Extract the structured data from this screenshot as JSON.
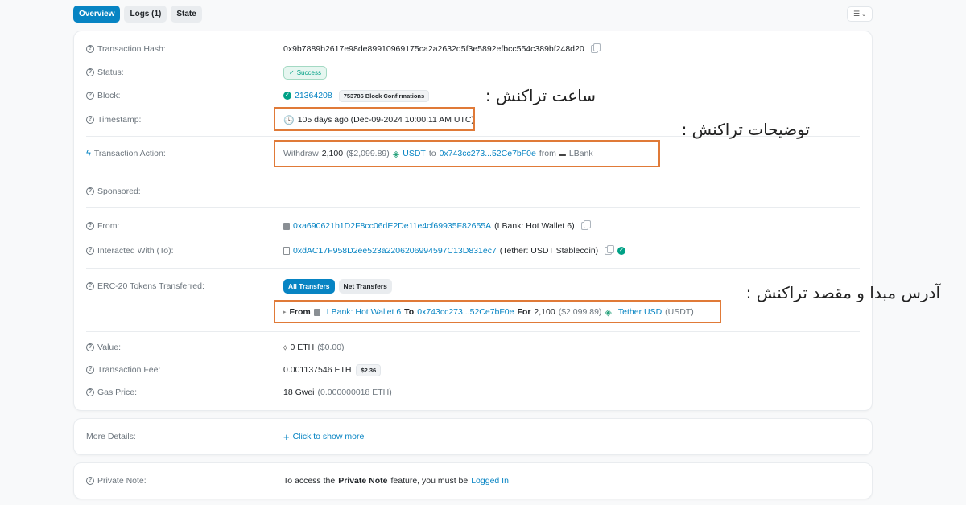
{
  "tabs": [
    {
      "label": "Overview",
      "active": true
    },
    {
      "label": "Logs (1)",
      "active": false
    },
    {
      "label": "State",
      "active": false
    }
  ],
  "tx": {
    "hash_label": "Transaction Hash:",
    "hash": "0x9b7889b2617e98de89910969175ca2a2632d5f3e5892efbcc554c389bf248d20",
    "status_label": "Status:",
    "status": "Success",
    "block_label": "Block:",
    "block": "21364208",
    "confirmations": "753786 Block Confirmations",
    "timestamp_label": "Timestamp:",
    "timestamp": "105 days ago (Dec-09-2024 10:00:11 AM UTC)",
    "action_label": "Transaction Action:",
    "action": {
      "verb": "Withdraw",
      "amount": "2,100",
      "usd": "($2,099.89)",
      "token": "USDT",
      "to_word": "to",
      "to_addr": "0x743cc273...52Ce7bF0e",
      "from_word": "from",
      "from_name": "LBank"
    },
    "sponsored_label": "Sponsored:",
    "from_label": "From:",
    "from_addr": "0xa690621b1D2F8cc06dE2De11e4cf69935F82655A",
    "from_name": "(LBank: Hot Wallet 6)",
    "to_label": "Interacted With (To):",
    "to_addr": "0xdAC17F958D2ee523a2206206994597C13D831ec7",
    "to_name": "(Tether: USDT Stablecoin)",
    "erc20_label": "ERC-20 Tokens Transferred:",
    "erc20_tabs": [
      "All Transfers",
      "Net Transfers"
    ],
    "transfer": {
      "from_word": "From",
      "from_name": "LBank: Hot Wallet 6",
      "to_word": "To",
      "to_addr": "0x743cc273...52Ce7bF0e",
      "for_word": "For",
      "amount": "2,100",
      "usd": "($2,099.89)",
      "token_name": "Tether USD",
      "token_symbol": "(USDT)"
    },
    "value_label": "Value:",
    "value": "0 ETH",
    "value_usd": "($0.00)",
    "fee_label": "Transaction Fee:",
    "fee": "0.001137546 ETH",
    "fee_usd": "$2.36",
    "gas_label": "Gas Price:",
    "gas": "18 Gwei",
    "gas_eth": "(0.000000018 ETH)"
  },
  "more": {
    "label": "More Details:",
    "link": "Click to show more"
  },
  "note": {
    "label": "Private Note:",
    "text_pre": "To access the",
    "text_bold": "Private Note",
    "text_mid": "feature, you must be",
    "link": "Logged In"
  },
  "annotations": {
    "time": "ساعت تراکنش :",
    "action": "توضیحات تراکنش :",
    "transfer": "آدرس مبدا و مقصد تراکنش :"
  },
  "colors": {
    "accent": "#0784c3",
    "success": "#00a186",
    "highlight_box": "#e07a38"
  }
}
